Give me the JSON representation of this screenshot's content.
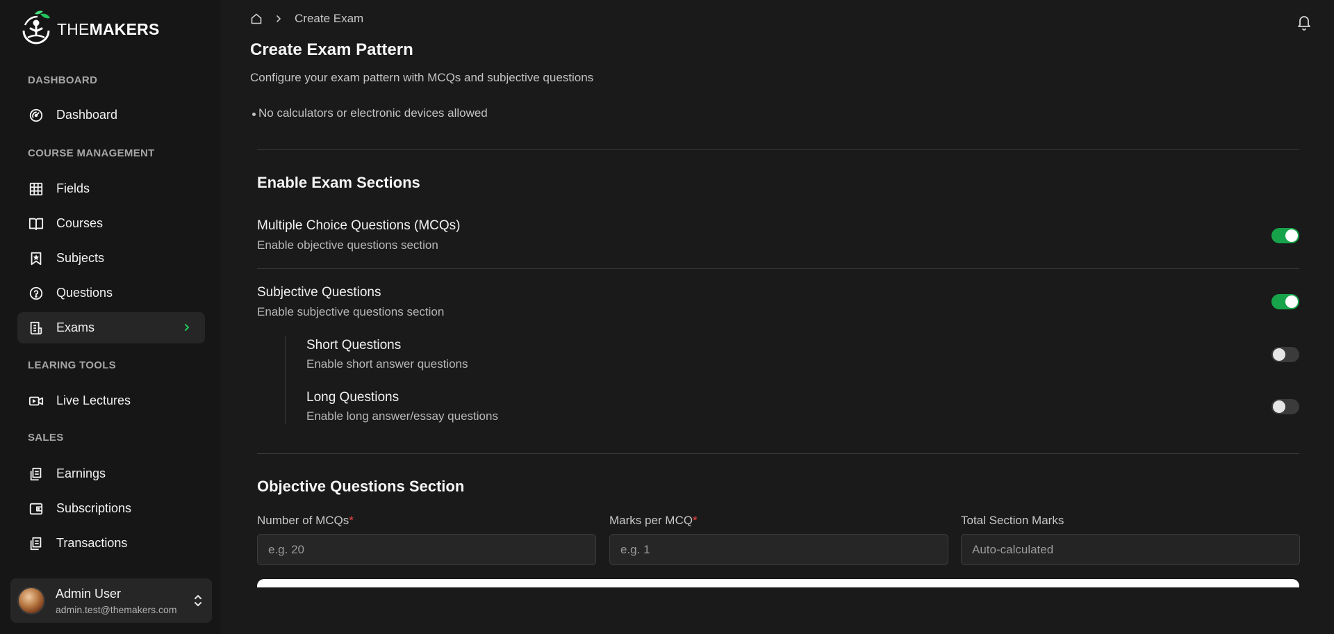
{
  "brand": {
    "name_prefix": "THE",
    "name_main": "MAKERS"
  },
  "sidebar": {
    "sections": {
      "dashboard": "DASHBOARD",
      "course_management": "COURSE MANAGEMENT",
      "learning_tools": "LEARING TOOLS",
      "sales": "SALES"
    },
    "items": {
      "dashboard": "Dashboard",
      "fields": "Fields",
      "courses": "Courses",
      "subjects": "Subjects",
      "questions": "Questions",
      "exams": "Exams",
      "live_lectures": "Live Lectures",
      "earnings": "Earnings",
      "subscriptions": "Subscriptions",
      "transactions": "Transactions"
    },
    "active_item": "exams",
    "user": {
      "name": "Admin User",
      "email": "admin.test@themakers.com"
    }
  },
  "breadcrumb": {
    "current": "Create Exam"
  },
  "page": {
    "title": "Create Exam Pattern",
    "subtitle": "Configure your exam pattern with MCQs and subjective questions",
    "bullets": [
      "No calculators or electronic devices allowed"
    ]
  },
  "enable_sections": {
    "title": "Enable Exam Sections",
    "mcq": {
      "title": "Multiple Choice Questions (MCQs)",
      "desc": "Enable objective questions section",
      "enabled": true
    },
    "subjective": {
      "title": "Subjective Questions",
      "desc": "Enable subjective questions section",
      "enabled": true
    },
    "short": {
      "title": "Short Questions",
      "desc": "Enable short answer questions",
      "enabled": false
    },
    "long": {
      "title": "Long Questions",
      "desc": "Enable long answer/essay questions",
      "enabled": false
    }
  },
  "objective_section": {
    "title": "Objective Questions Section",
    "fields": {
      "num_mcqs": {
        "label": "Number of MCQs",
        "required": "*",
        "placeholder": "e.g. 20",
        "value": ""
      },
      "marks_per_mcq": {
        "label": "Marks per MCQ",
        "required": "*",
        "placeholder": "e.g. 1",
        "value": ""
      },
      "total_marks": {
        "label": "Total Section Marks",
        "placeholder": "Auto-calculated",
        "value": ""
      }
    }
  },
  "colors": {
    "toggle_on": "#16a34a",
    "required": "#ef4444",
    "background": "#1a1a1a",
    "sidebar": "#161616"
  }
}
